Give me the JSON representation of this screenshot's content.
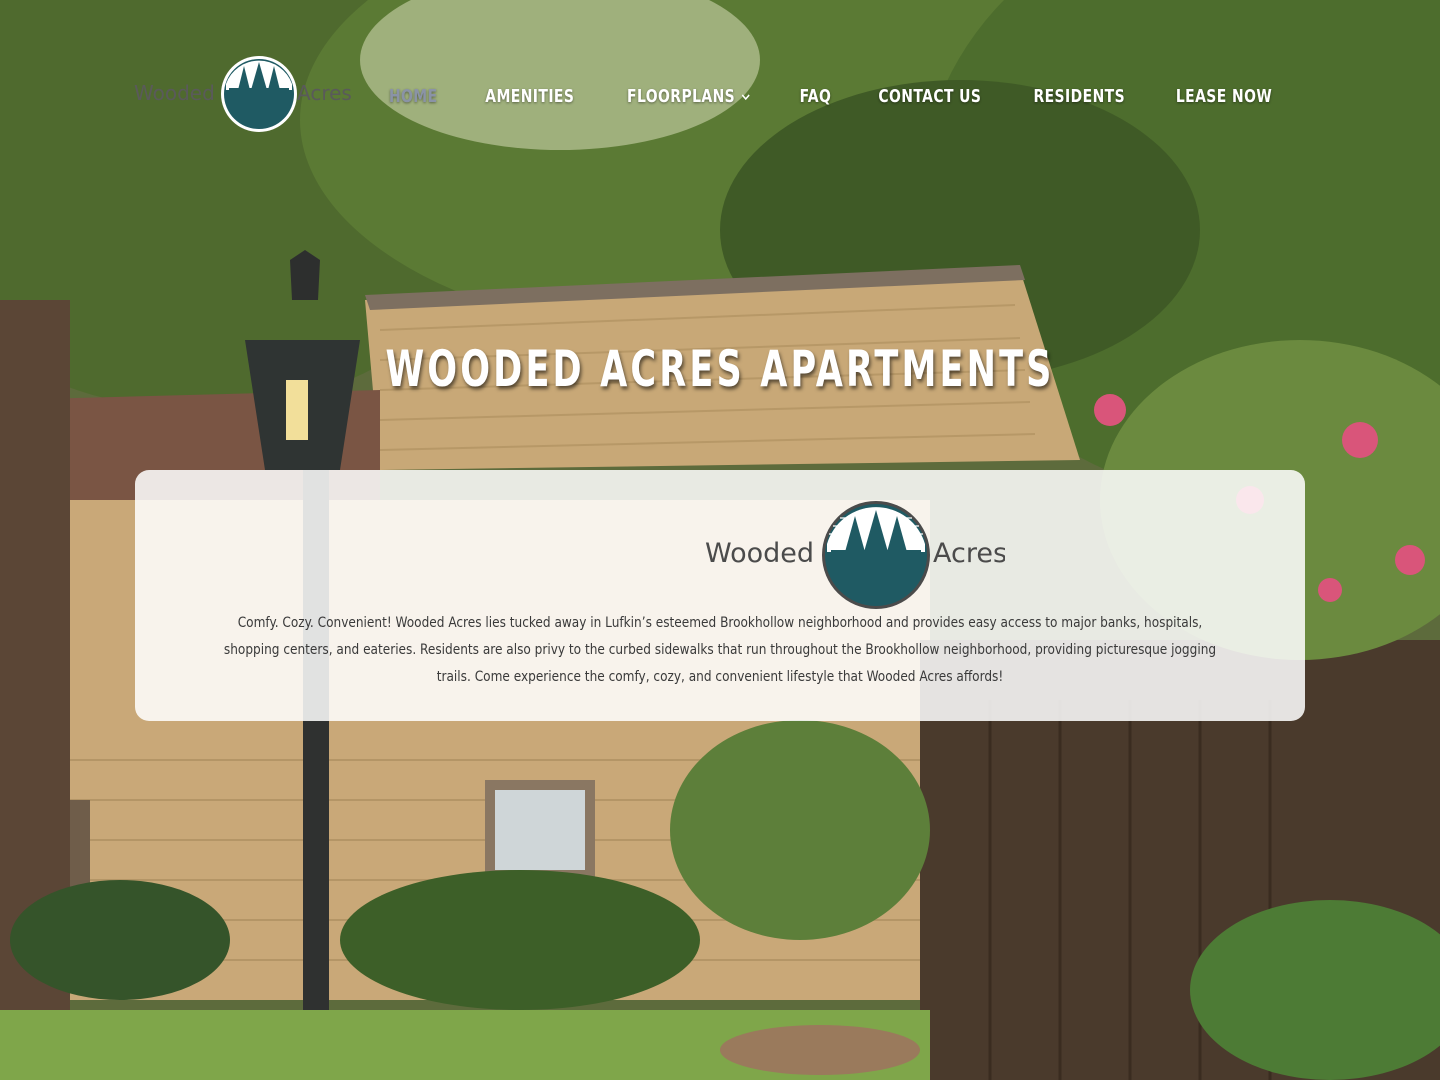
{
  "site": {
    "logo_left": "Wooded",
    "logo_right": "Acres"
  },
  "nav": {
    "items": [
      {
        "label": "HOME",
        "active": true
      },
      {
        "label": "AMENITIES"
      },
      {
        "label": "FLOORPLANS",
        "has_dropdown": true
      },
      {
        "label": "FAQ"
      },
      {
        "label": "CONTACT US"
      },
      {
        "label": "RESIDENTS"
      },
      {
        "label": "LEASE NOW"
      }
    ]
  },
  "hero": {
    "title": "WOODED ACRES APARTMENTS"
  },
  "intro": {
    "logo_left": "Wooded",
    "logo_right": "Acres",
    "text": "Comfy. Cozy. Convenient! Wooded Acres lies tucked away in Lufkin’s esteemed Brookhollow neighborhood and provides easy access to major banks, hospitals, shopping centers, and eateries. Residents are also privy to the curbed sidewalks that run throughout the Brookhollow neighborhood, providing picturesque jogging trails. Come experience the comfy, cozy, and convenient lifestyle that Wooded Acres affords!"
  },
  "colors": {
    "logo_teal": "#1f5a63",
    "active_nav": "#8a93a6",
    "logo_text": "#4b4b4b"
  }
}
